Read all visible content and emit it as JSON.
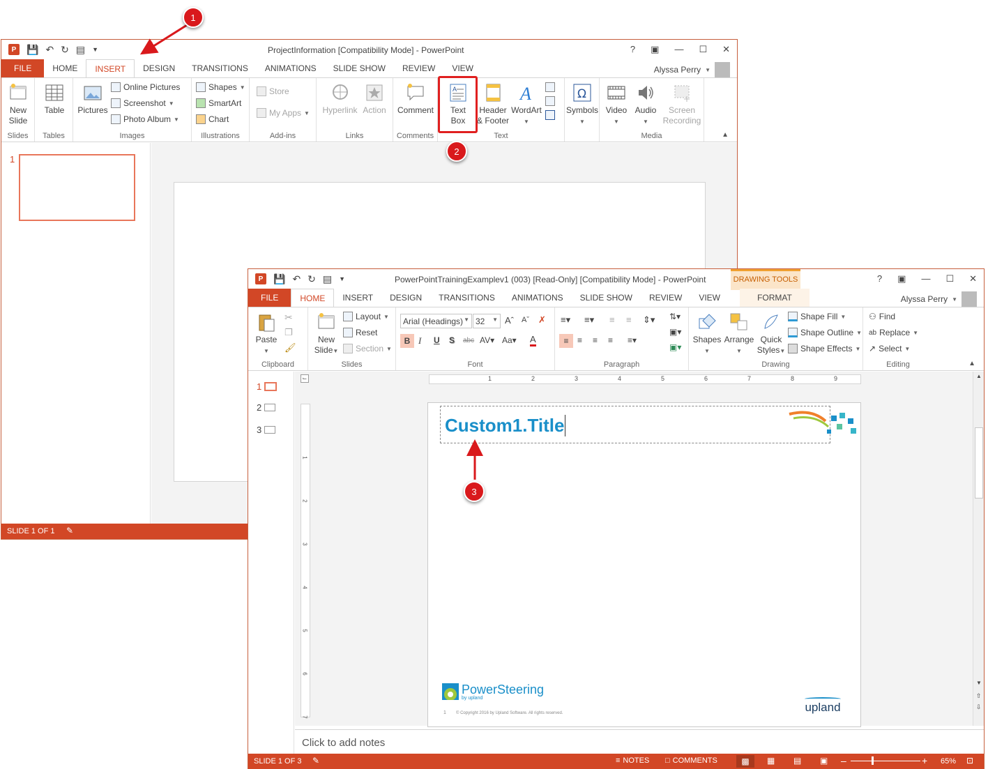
{
  "back": {
    "title": "ProjectInformation [Compatibility Mode] - PowerPoint",
    "user": "Alyssa Perry",
    "tabs": [
      "FILE",
      "HOME",
      "INSERT",
      "DESIGN",
      "TRANSITIONS",
      "ANIMATIONS",
      "SLIDE SHOW",
      "REVIEW",
      "VIEW"
    ],
    "groups": [
      "Slides",
      "Tables",
      "Images",
      "Illustrations",
      "Add-ins",
      "Links",
      "Comments",
      "Text",
      "Media"
    ],
    "buttons": {
      "new_slide": "New Slide",
      "table": "Table",
      "pictures": "Pictures",
      "online_pictures": "Online Pictures",
      "screenshot": "Screenshot",
      "photo_album": "Photo Album",
      "shapes": "Shapes",
      "smartart": "SmartArt",
      "chart": "Chart",
      "store": "Store",
      "my_apps": "My Apps",
      "hyperlink": "Hyperlink",
      "action": "Action",
      "comment": "Comment",
      "text_box_1": "Text",
      "text_box_2": "Box",
      "header_1": "Header",
      "header_2": "& Footer",
      "wordart": "WordArt",
      "symbols": "Symbols",
      "video": "Video",
      "audio": "Audio",
      "screen_rec_1": "Screen",
      "screen_rec_2": "Recording"
    },
    "slide_number": "1",
    "status": "SLIDE 1 OF 1"
  },
  "front": {
    "title": "PowerPointTrainingExamplev1 (003) [Read-Only] [Compatibility Mode] - PowerPoint",
    "drawing_tools": "DRAWING TOOLS",
    "user": "Alyssa Perry",
    "tabs": [
      "FILE",
      "HOME",
      "INSERT",
      "DESIGN",
      "TRANSITIONS",
      "ANIMATIONS",
      "SLIDE SHOW",
      "REVIEW",
      "VIEW",
      "FORMAT"
    ],
    "groups": [
      "Clipboard",
      "Slides",
      "Font",
      "Paragraph",
      "Drawing",
      "Editing"
    ],
    "buttons": {
      "paste": "Paste",
      "new_slide_1": "New",
      "new_slide_2": "Slide",
      "layout": "Layout",
      "reset": "Reset",
      "section": "Section",
      "shapes": "Shapes",
      "arrange": "Arrange",
      "quick_1": "Quick",
      "quick_2": "Styles",
      "shape_fill": "Shape Fill",
      "shape_outline": "Shape Outline",
      "shape_effects": "Shape Effects",
      "find": "Find",
      "replace": "Replace",
      "select": "Select"
    },
    "font_name": "Arial (Headings)",
    "font_size": "32",
    "slide_numbers": [
      "1",
      "2",
      "3"
    ],
    "ruler_numbers": [
      "1",
      "2",
      "3",
      "4",
      "5",
      "6",
      "7",
      "8",
      "9"
    ],
    "vruler_numbers": [
      "1",
      "2",
      "3",
      "4",
      "5",
      "6",
      "7"
    ],
    "slide_title": "Custom1.Title",
    "logo_text": "PowerSteering",
    "logo_sub": "by upland",
    "page_number": "1",
    "copyright": "© Copyright 2016 by Upland Software. All rights reserved.",
    "upland": "upland",
    "notes_placeholder": "Click to add notes",
    "status": "SLIDE 1 OF 3",
    "notes_btn": "NOTES",
    "comments_btn": "COMMENTS",
    "zoom": "65%"
  },
  "callouts": [
    "1",
    "2",
    "3"
  ],
  "colors": {
    "accent": "#d24726",
    "title_blue": "#1a8fc9",
    "callout_red": "#d9191c"
  }
}
